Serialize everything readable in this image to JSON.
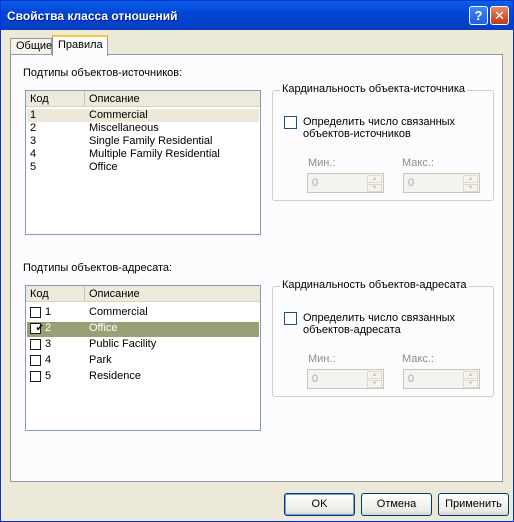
{
  "window": {
    "title": "Свойства класса отношений",
    "help_glyph": "?",
    "close_glyph": "✕"
  },
  "tabs": [
    {
      "label": "Общие"
    },
    {
      "label": "Правила"
    }
  ],
  "origin": {
    "section_label": "Подтипы объектов-источников:",
    "columns": [
      "Код",
      "Описание"
    ],
    "rows": [
      {
        "code": "1",
        "desc": "Commercial"
      },
      {
        "code": "2",
        "desc": "Miscellaneous"
      },
      {
        "code": "3",
        "desc": "Single Family Residential"
      },
      {
        "code": "4",
        "desc": "Multiple Family Residential"
      },
      {
        "code": "5",
        "desc": "Office"
      }
    ],
    "cardinality": {
      "title": "Кардинальность объекта-источника",
      "check_line1": "Определить число связанных",
      "check_line2": "объектов-источников",
      "min_label": "Мин.:",
      "max_label": "Макс.:",
      "min_value": "0",
      "max_value": "0"
    }
  },
  "destination": {
    "section_label": "Подтипы объектов-адресата:",
    "columns": [
      "Код",
      "Описание"
    ],
    "rows": [
      {
        "code": "1",
        "desc": "Commercial",
        "checked": false
      },
      {
        "code": "2",
        "desc": "Office",
        "checked": true
      },
      {
        "code": "3",
        "desc": "Public Facility",
        "checked": false
      },
      {
        "code": "4",
        "desc": "Park",
        "checked": false
      },
      {
        "code": "5",
        "desc": "Residence",
        "checked": false
      }
    ],
    "check_mark": "✔",
    "cardinality": {
      "title": "Кардинальность объектов-адресата",
      "check_line1": "Определить число связанных",
      "check_line2": "объектов-адресата",
      "min_label": "Мин.:",
      "max_label": "Макс.:",
      "min_value": "0",
      "max_value": "0"
    }
  },
  "spin_up": "▲",
  "spin_down": "▼",
  "buttons": {
    "ok": "OK",
    "cancel": "Отмена",
    "apply": "Применить"
  }
}
